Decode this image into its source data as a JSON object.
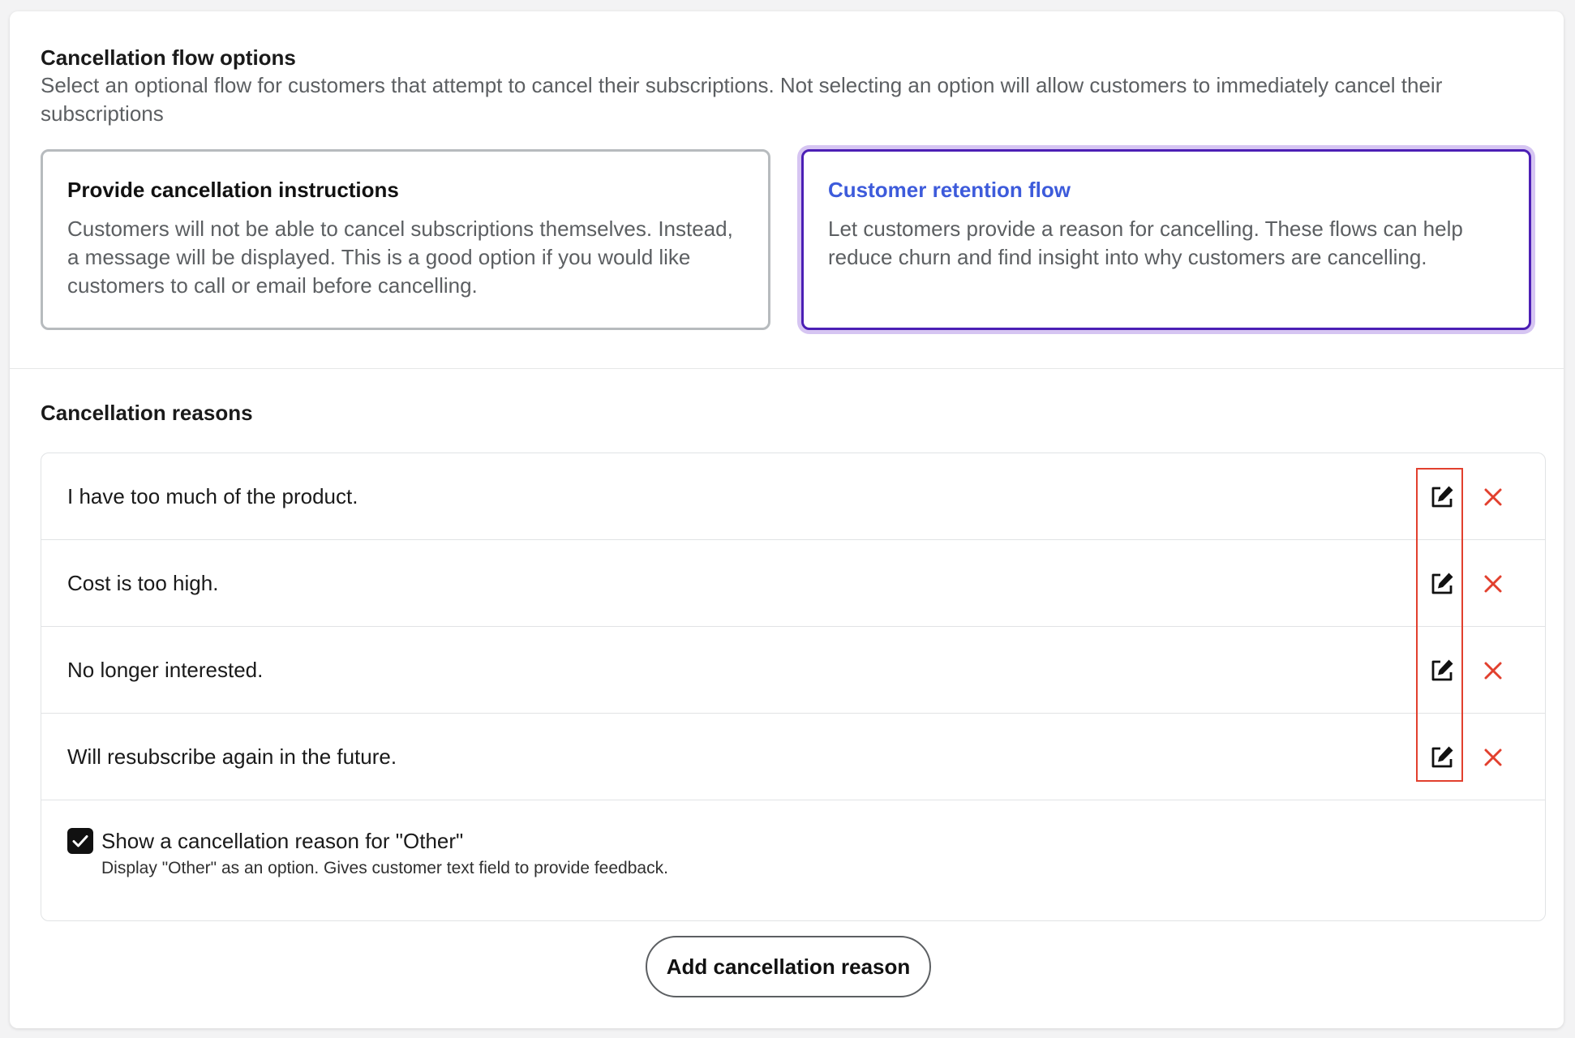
{
  "flow_options": {
    "title": "Cancellation flow options",
    "description": "Select an optional flow for customers that attempt to cancel their subscriptions. Not selecting an option will allow customers to immediately cancel their subscriptions",
    "options": [
      {
        "title": "Provide cancellation instructions",
        "description": "Customers will not be able to cancel subscriptions themselves. Instead, a message will be displayed. This is a good option if you would like customers to call or email before cancelling.",
        "selected": false
      },
      {
        "title": "Customer retention flow",
        "description": "Let customers provide a reason for cancelling. These flows can help reduce churn and find insight into why customers are cancelling.",
        "selected": true
      }
    ]
  },
  "reasons": {
    "title": "Cancellation reasons",
    "items": [
      {
        "label": "I have too much of the product."
      },
      {
        "label": "Cost is too high."
      },
      {
        "label": "No longer interested."
      },
      {
        "label": "Will resubscribe again in the future."
      }
    ],
    "other": {
      "checked": true,
      "label": "Show a cancellation reason for \"Other\"",
      "help": "Display \"Other\" as an option. Gives customer text field to provide feedback."
    },
    "add_button_label": "Add cancellation reason"
  },
  "icons": {
    "edit": "edit-icon",
    "delete": "close-icon",
    "check": "checkmark-icon"
  },
  "colors": {
    "selected_border": "#4c1fb5",
    "selected_title": "#3d5bdb",
    "delete_icon": "#e2402e",
    "highlight": "#e2402e"
  }
}
